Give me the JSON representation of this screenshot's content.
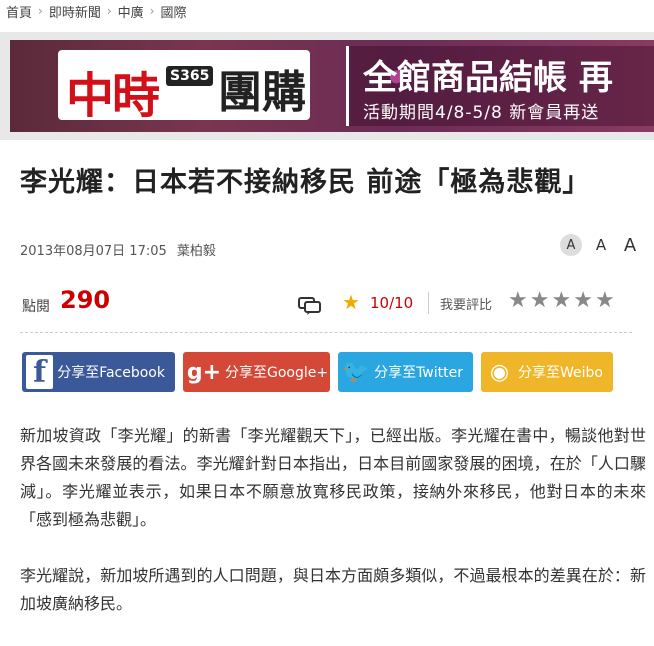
{
  "breadcrumb": [
    {
      "label": "首頁"
    },
    {
      "label": "即時新聞"
    },
    {
      "label": "中廣"
    },
    {
      "label": "國際"
    }
  ],
  "banner": {
    "logo_part1": "中時",
    "logo_badge": "S365",
    "logo_part2": "團購",
    "promo_title": "全館商品結帳 再",
    "promo_subtitle": "活動期間4/8-5/8 新會員再送"
  },
  "article": {
    "headline": "李光耀：日本若不接納移民 前途「極為悲觀」",
    "date": "2013年08月07日 17:05",
    "author": "葉柏毅",
    "paragraphs": [
      "新加坡資政「李光耀」的新書「李光耀觀天下」，已經出版。李光耀在書中，暢談他對世界各國未來發展的看法。李光耀針對日本指出，日本目前國家發展的困境，在於「人口驟減」。李光耀並表示，如果日本不願意放寬移民政策，接納外來移民，他對日本的未來「感到極為悲觀」。",
      "李光耀說，新加坡所遇到的人口問題，與日本方面頗多類似，不過最根本的差異在於：新加坡廣納移民。"
    ]
  },
  "font_size": {
    "small": "A",
    "medium": "A",
    "large": "A"
  },
  "stats": {
    "views_label": "點閱",
    "views_count": "290",
    "score": "10/10",
    "rate_label": "我要評比",
    "rate_star": "★"
  },
  "share": {
    "facebook": "分享至Facebook",
    "facebook_icon": "f",
    "google": "分享至Google+",
    "google_icon": "g+",
    "twitter": "分享至Twitter",
    "twitter_icon": "🐦",
    "weibo": "分享至Weibo",
    "weibo_icon": "◉"
  },
  "colors": {
    "facebook": "#3b5998",
    "google": "#d34836",
    "twitter": "#2aa7e0",
    "weibo": "#f0b629",
    "views": "#cc0000"
  }
}
